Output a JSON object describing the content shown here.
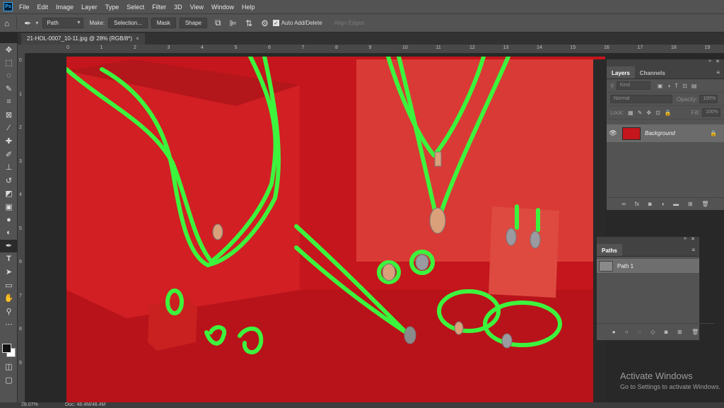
{
  "app": {
    "logo": "Ps"
  },
  "menu": [
    "File",
    "Edit",
    "Image",
    "Layer",
    "Type",
    "Select",
    "Filter",
    "3D",
    "View",
    "Window",
    "Help"
  ],
  "options": {
    "mode": "Path",
    "make_label": "Make:",
    "selection_btn": "Selection...",
    "mask_btn": "Mask",
    "shape_btn": "Shape",
    "auto_add_delete": "Auto Add/Delete",
    "align_edges": "Align Edges"
  },
  "document": {
    "tab_title": "21-HOL-0007_10-11.jpg @ 28% (RGB/8*)",
    "close": "×"
  },
  "ruler": {
    "top": [
      "0",
      "1",
      "2",
      "3",
      "4",
      "5",
      "6",
      "7",
      "8",
      "9",
      "10",
      "11",
      "12",
      "13",
      "14",
      "15",
      "16",
      "17",
      "18",
      "19"
    ],
    "left": [
      "0",
      "1",
      "2",
      "3",
      "4",
      "5",
      "6",
      "7",
      "8",
      "9"
    ]
  },
  "layers_panel": {
    "tabs": [
      "Layers",
      "Channels"
    ],
    "filter_kind": "Kind",
    "blend_mode": "Normal",
    "opacity_label": "Opacity:",
    "opacity_value": "100%",
    "lock_label": "Lock:",
    "fill_label": "Fill:",
    "fill_value": "100%",
    "layer_name": "Background"
  },
  "paths_panel": {
    "title": "Paths",
    "path_name": "Path 1"
  },
  "watermark": {
    "line1": "Activate Windows",
    "line2": "Go to Settings to activate Windows."
  },
  "status": {
    "zoom": "28.07%",
    "doc": "Doc: 48.4M/48.4M"
  },
  "colors": {
    "path": "#3df43d",
    "backdrop": "#c4161c",
    "ui_panel": "#535353"
  }
}
